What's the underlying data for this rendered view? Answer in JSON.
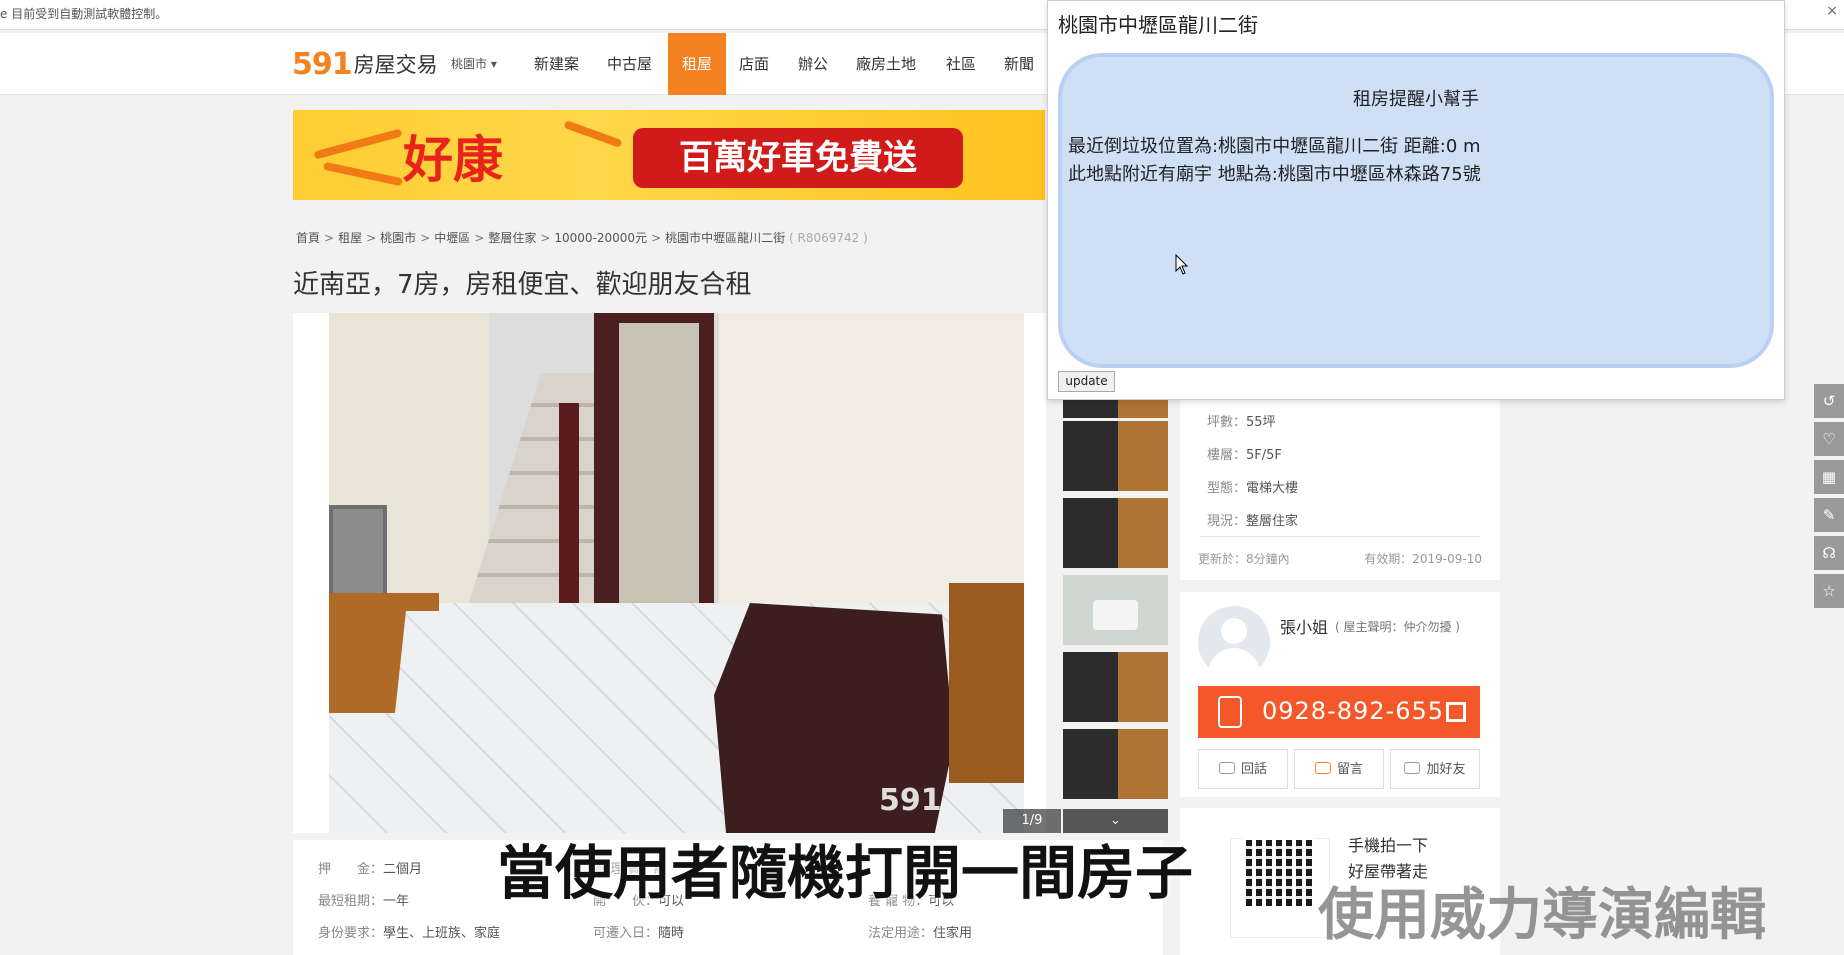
{
  "automation_bar": {
    "text": "e 目前受到自動測試軟體控制。",
    "close": "×"
  },
  "header": {
    "logo_num": "591",
    "logo_text": "房屋交易",
    "city": "桃園市 ▾",
    "nav": [
      "新建案",
      "中古屋",
      "租屋",
      "店面",
      "辦公",
      "廠房土地",
      "社區",
      "新聞"
    ],
    "active_nav": "租屋"
  },
  "banner": {
    "left_text": "好康",
    "right_text": "百萬好車免費送"
  },
  "breadcrumb": {
    "items": [
      "首頁",
      "租屋",
      "桃園市",
      "中壢區",
      "整層住家",
      "10000-20000元",
      "桃園市中壢區龍川二街"
    ],
    "id": "( R8069742 )",
    "sep": ">"
  },
  "listing": {
    "title": "近南亞，7房，房租便宜、歡迎朋友合租",
    "photo_watermark": "591",
    "photo_counter": "1/9",
    "thumb_more": "⌄"
  },
  "info_rows": [
    {
      "label": "押　　金：",
      "value": "二個月"
    },
    {
      "label": "最短租期：",
      "value": "一年"
    },
    {
      "label": "身份要求：",
      "value": "學生、上班族、家庭"
    },
    {
      "label": "開　　伙：",
      "value": "可以"
    },
    {
      "label": "可遷入日：",
      "value": "隨時"
    },
    {
      "label": "養 寵 物：",
      "value": "可以"
    },
    {
      "label": "法定用途：",
      "value": "住家用"
    },
    {
      "label": "管 理 費：",
      "value": "無"
    }
  ],
  "side_specs": {
    "rows": [
      {
        "label": "坪數：",
        "value": "55坪"
      },
      {
        "label": "樓層：",
        "value": "5F/5F"
      },
      {
        "label": "型態：",
        "value": "電梯大樓"
      },
      {
        "label": "現況：",
        "value": "整層住家"
      }
    ],
    "updated": "更新於：8分鐘內",
    "expires": "有效期：2019-09-10"
  },
  "agent": {
    "name": "張小姐",
    "note": "( 屋主聲明：仲介勿擾 )",
    "phone": "0928-892-655",
    "actions": [
      "回話",
      "留言",
      "加好友"
    ]
  },
  "qr_card": {
    "line1": "手機拍一下",
    "line2": "好屋帶著走"
  },
  "side_tools": [
    "↺",
    "♡",
    "▦",
    "✎",
    "☊",
    "☆"
  ],
  "popup": {
    "title": "桃園市中壢區龍川二街",
    "heading": "租房提醒小幫手",
    "line1": "最近倒垃圾位置為:桃園市中壢區龍川二街 距離:0 m",
    "line2": "此地點附近有廟宇 地點為:桃園市中壢區林森路75號",
    "button": "update"
  },
  "subtitle": "當使用者隨機打開一間房子",
  "video_watermark": "使用威力導演編輯",
  "colors": {
    "brand_orange": "#f58220",
    "phone_red": "#f4572a",
    "bubble_blue": "#cfdff6"
  }
}
